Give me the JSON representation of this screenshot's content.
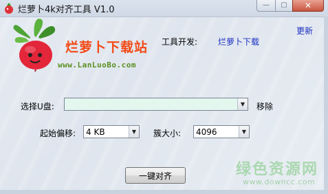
{
  "window": {
    "title": "烂萝卜4k对齐工具 V1.0"
  },
  "titlebar_buttons": {
    "minimize_glyph": "—",
    "maximize_glyph": "▢",
    "close_glyph": "✕"
  },
  "header": {
    "brand": "烂萝卜下载站",
    "site_url": "www.LanLuoBo.com",
    "developer_label": "工具开发:",
    "developer_value": "烂萝卜下载",
    "update_link": "更新"
  },
  "form": {
    "usb_label": "选择U盘:",
    "usb_value": "",
    "remove_label": "移除",
    "offset_label": "起始偏移:",
    "offset_value": "4 KB",
    "cluster_label": "簇大小:",
    "cluster_value": "4096",
    "align_button": "一键对齐"
  },
  "watermark": {
    "main": "绿色资源网",
    "url": "www.downcc.com"
  },
  "icons": {
    "app": "radish-icon",
    "logo": "radish-mascot-logo",
    "dropdown": "chevron-down-icon"
  },
  "colors": {
    "brand": "#f34a17",
    "link": "#1a2fc0",
    "site_url": "#5a8f1f",
    "usb_field_bg": "#e4f7ef"
  }
}
